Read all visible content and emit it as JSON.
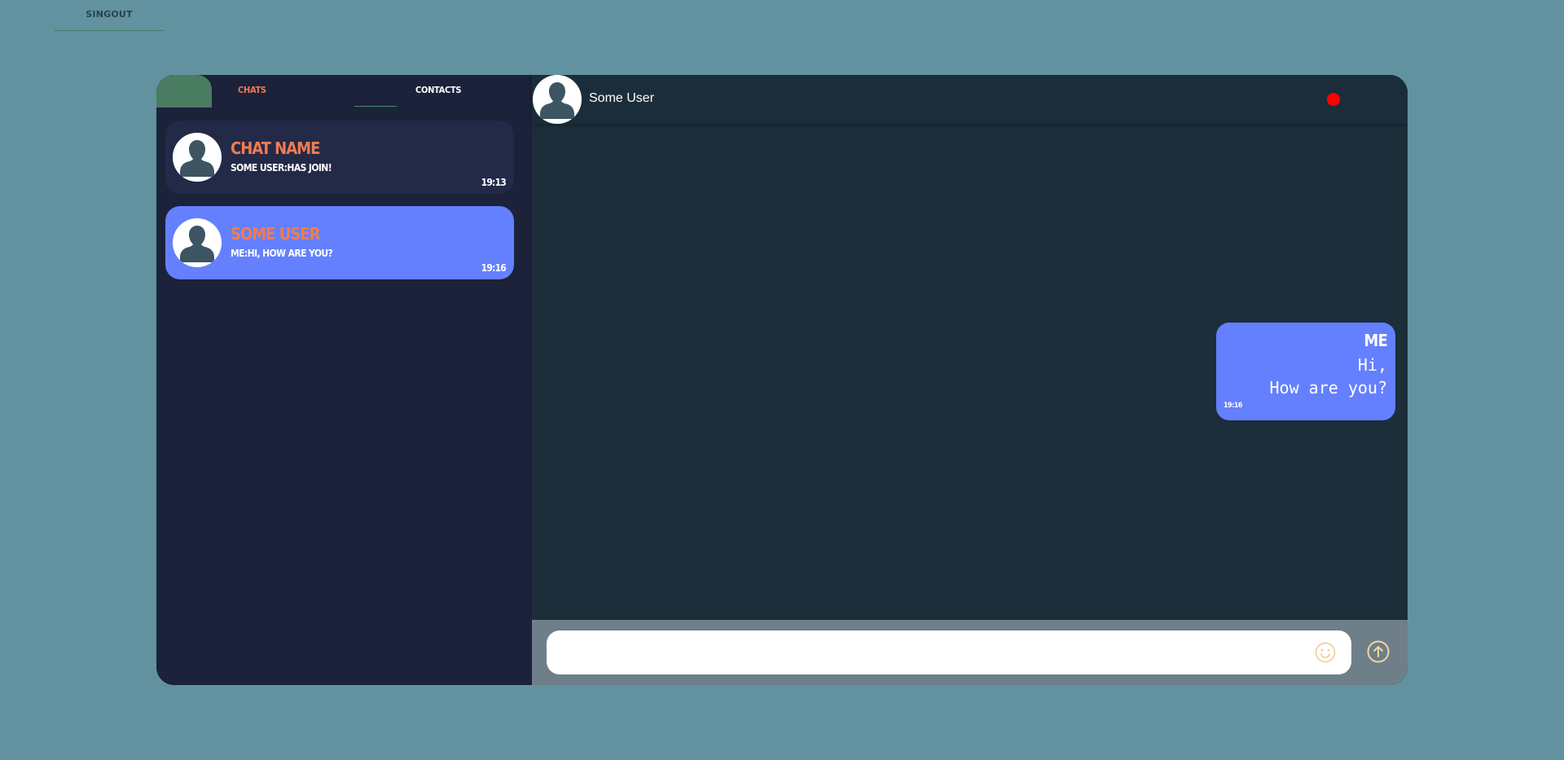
{
  "topbar": {
    "signout_label": "SINGOUT"
  },
  "sidebar": {
    "tabs": [
      {
        "label": "CHATS",
        "active": true
      },
      {
        "label": "CONTACTS",
        "active": false
      }
    ],
    "chats": [
      {
        "name": "CHAT NAME",
        "last_message": "SOME USER:HAS JOIN!",
        "time": "19:13",
        "selected": false
      },
      {
        "name": "SOME USER",
        "last_message": "ME:HI, HOW ARE YOU?",
        "time": "19:16",
        "selected": true
      }
    ]
  },
  "conversation": {
    "title": "Some User",
    "status_color": "#ff0000",
    "messages": [
      {
        "sender": "ME",
        "text": "Hi,\nHow are you?",
        "time": "19:16"
      }
    ],
    "composer": {
      "input_value": "",
      "emoji_icon": "smiley-icon",
      "send_icon": "arrow-up-circle-icon"
    }
  },
  "colors": {
    "background": "#6292a0",
    "sidebar": "#1b223a",
    "conversation": "#1c2e3a",
    "accent_orange": "#f07c4f",
    "accent_blue": "#6480fe",
    "tab_marker": "#4a7c61"
  }
}
